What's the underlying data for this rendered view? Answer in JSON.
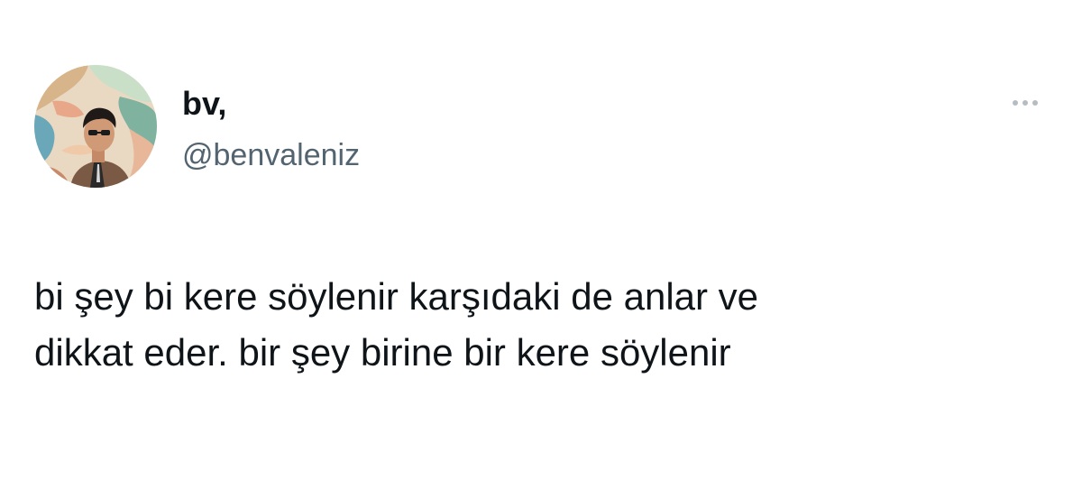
{
  "tweet": {
    "author": {
      "display_name": "bv,",
      "handle": "@benvaleniz",
      "avatar_icon": "profile-photo"
    },
    "more_icon": "more-horizontal-icon",
    "text_lines": [
      "bi şey bi kere söylenir karşıdaki de anlar ve",
      "dikkat eder. bir şey birine bir kere söylenir"
    ]
  },
  "colors": {
    "text_primary": "#0f1419",
    "text_secondary": "#536471",
    "background": "#ffffff"
  }
}
